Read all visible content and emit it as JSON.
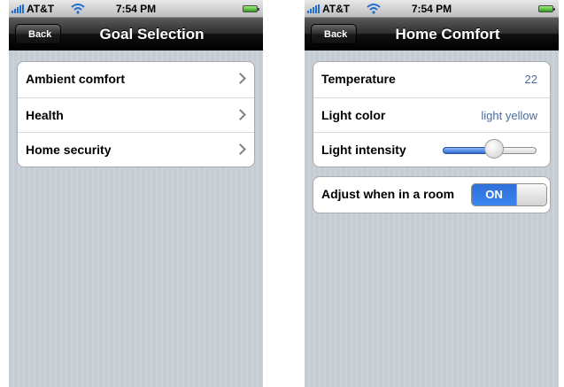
{
  "status_bar": {
    "carrier": "AT&T",
    "time": "7:54 PM"
  },
  "goal_selection": {
    "back_label": "Back",
    "title": "Goal Selection",
    "items": [
      {
        "label": "Ambient comfort"
      },
      {
        "label": "Health"
      },
      {
        "label": "Home security"
      }
    ]
  },
  "home_comfort": {
    "back_label": "Back",
    "title": "Home Comfort",
    "temperature_label": "Temperature",
    "temperature_value": "22",
    "light_color_label": "Light color",
    "light_color_value": "light yellow",
    "light_intensity_label": "Light intensity",
    "light_intensity_fraction": 0.55,
    "adjust_label": "Adjust when in a room",
    "adjust_toggle_label": "ON",
    "adjust_toggle_on": true
  },
  "colors": {
    "accent_blue": "#3b7ee6",
    "value_text": "#4a6d9c",
    "background_stripes": "#c5ccd4"
  },
  "icons": [
    "signal-bars-icon",
    "wifi-icon",
    "battery-icon",
    "chevron-right-icon"
  ]
}
